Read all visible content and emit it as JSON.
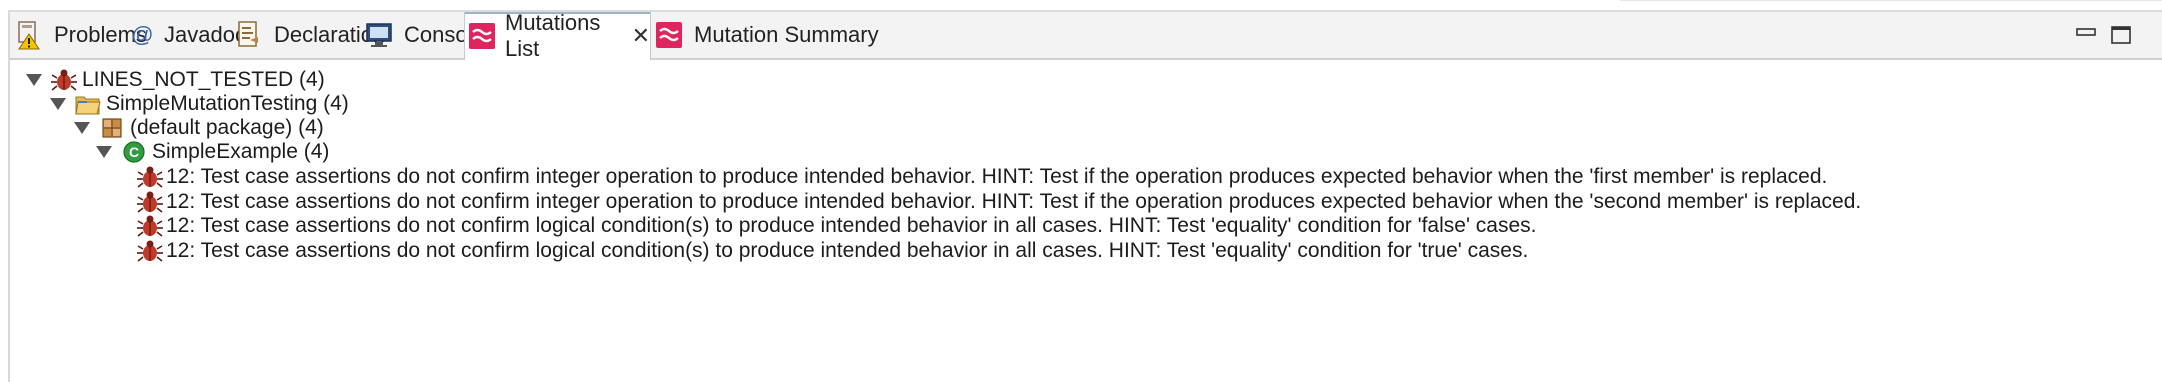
{
  "tabs": [
    {
      "label": "Problems",
      "icon": "problems-icon"
    },
    {
      "label": "Javadoc",
      "icon": "javadoc-icon"
    },
    {
      "label": "Declaration",
      "icon": "declaration-icon"
    },
    {
      "label": "Console",
      "icon": "console-icon"
    },
    {
      "label": "Mutations List",
      "icon": "mutations-icon",
      "active": true,
      "close_glyph": "✕"
    },
    {
      "label": "Mutation Summary",
      "icon": "mutations-icon"
    }
  ],
  "tree": {
    "root": {
      "label": "LINES_NOT_TESTED (4)",
      "icon": "bug-icon"
    },
    "project": {
      "label": "SimpleMutationTesting (4)",
      "icon": "folder-icon"
    },
    "package": {
      "label": "(default package) (4)",
      "icon": "package-icon"
    },
    "class": {
      "label": "SimpleExample (4)",
      "icon": "class-icon",
      "glyph": "C"
    },
    "items": [
      {
        "label": "12: Test case assertions do not confirm integer operation to produce intended behavior. HINT: Test if the operation produces expected behavior when the 'first member' is replaced."
      },
      {
        "label": "12: Test case assertions do not confirm integer operation to produce intended behavior. HINT: Test if the operation produces expected behavior when the 'second member' is replaced."
      },
      {
        "label": "12: Test case assertions do not confirm logical condition(s) to produce intended behavior in all cases. HINT: Test 'equality' condition for 'false' cases."
      },
      {
        "label": "12: Test case assertions do not confirm logical condition(s) to produce intended behavior in all cases. HINT: Test 'equality' condition for 'true' cases."
      }
    ]
  },
  "colors": {
    "mutations_pink": "#e0245e",
    "bug_red": "#c0392b",
    "class_green": "#2e9e3e",
    "folder_blue": "#3b7fc4"
  }
}
